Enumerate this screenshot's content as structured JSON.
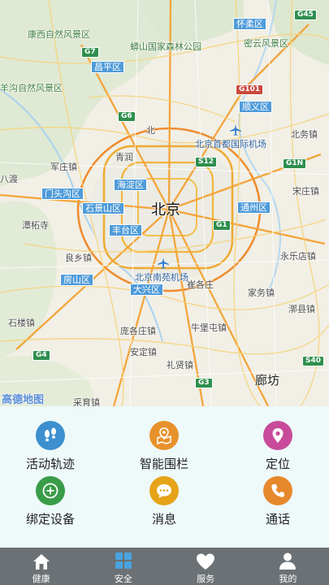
{
  "map": {
    "provider_logo": "高德地图",
    "city_center": "北京",
    "cities": [
      "廊坊"
    ],
    "districts": [
      "怀柔区",
      "昌平区",
      "顺义区",
      "海淀区",
      "门头沟区",
      "石景山区",
      "丰台区",
      "通州区",
      "房山区",
      "大兴区"
    ],
    "parks": [
      "康西自然风景区",
      "蟒山国家森林公园",
      "密云风景区",
      "羊沟自然风景区"
    ],
    "places": [
      "北",
      "青润",
      "八渡",
      "军庄镇",
      "潭柘寺",
      "良乡镇",
      "石楼镇",
      "庞各庄镇",
      "礼贤镇",
      "安定镇",
      "牛堡屯镇",
      "永乐店镇",
      "家务镇",
      "漷县镇",
      "北务镇",
      "宋庄镇",
      "采育镇",
      "崔各庄"
    ],
    "airports": [
      "北京首都国际机场",
      "北京南苑机场"
    ],
    "highways": [
      {
        "code": "G7",
        "type": "green"
      },
      {
        "code": "G6",
        "type": "green"
      },
      {
        "code": "G45",
        "type": "green"
      },
      {
        "code": "G101",
        "type": "red"
      },
      {
        "code": "S12",
        "type": "green"
      },
      {
        "code": "G1",
        "type": "green"
      },
      {
        "code": "G1N",
        "type": "green"
      },
      {
        "code": "G4",
        "type": "green"
      },
      {
        "code": "G3",
        "type": "green"
      },
      {
        "code": "S40",
        "type": "green"
      }
    ]
  },
  "functions": [
    {
      "label": "活动轨迹",
      "icon": "footprints-icon",
      "color": "#3d8fcf"
    },
    {
      "label": "智能围栏",
      "icon": "map-pin-fence-icon",
      "color": "#e6912b"
    },
    {
      "label": "定位",
      "icon": "location-pin-icon",
      "color": "#c74b9a"
    },
    {
      "label": "绑定设备",
      "icon": "add-circle-icon",
      "color": "#3a9c48"
    },
    {
      "label": "消息",
      "icon": "chat-bubble-icon",
      "color": "#e5a318"
    },
    {
      "label": "通话",
      "icon": "phone-icon",
      "color": "#e7882c"
    }
  ],
  "tabs": [
    {
      "label": "健康",
      "icon": "home-icon",
      "active": false
    },
    {
      "label": "安全",
      "icon": "grid-icon",
      "active": true
    },
    {
      "label": "服务",
      "icon": "heart-icon",
      "active": false
    },
    {
      "label": "我的",
      "icon": "user-icon",
      "active": false
    }
  ],
  "colors": {
    "tabbar": "#6b7174",
    "grid_bg": "#eef9fa",
    "active_tab_icon": "#4aa3e0"
  }
}
